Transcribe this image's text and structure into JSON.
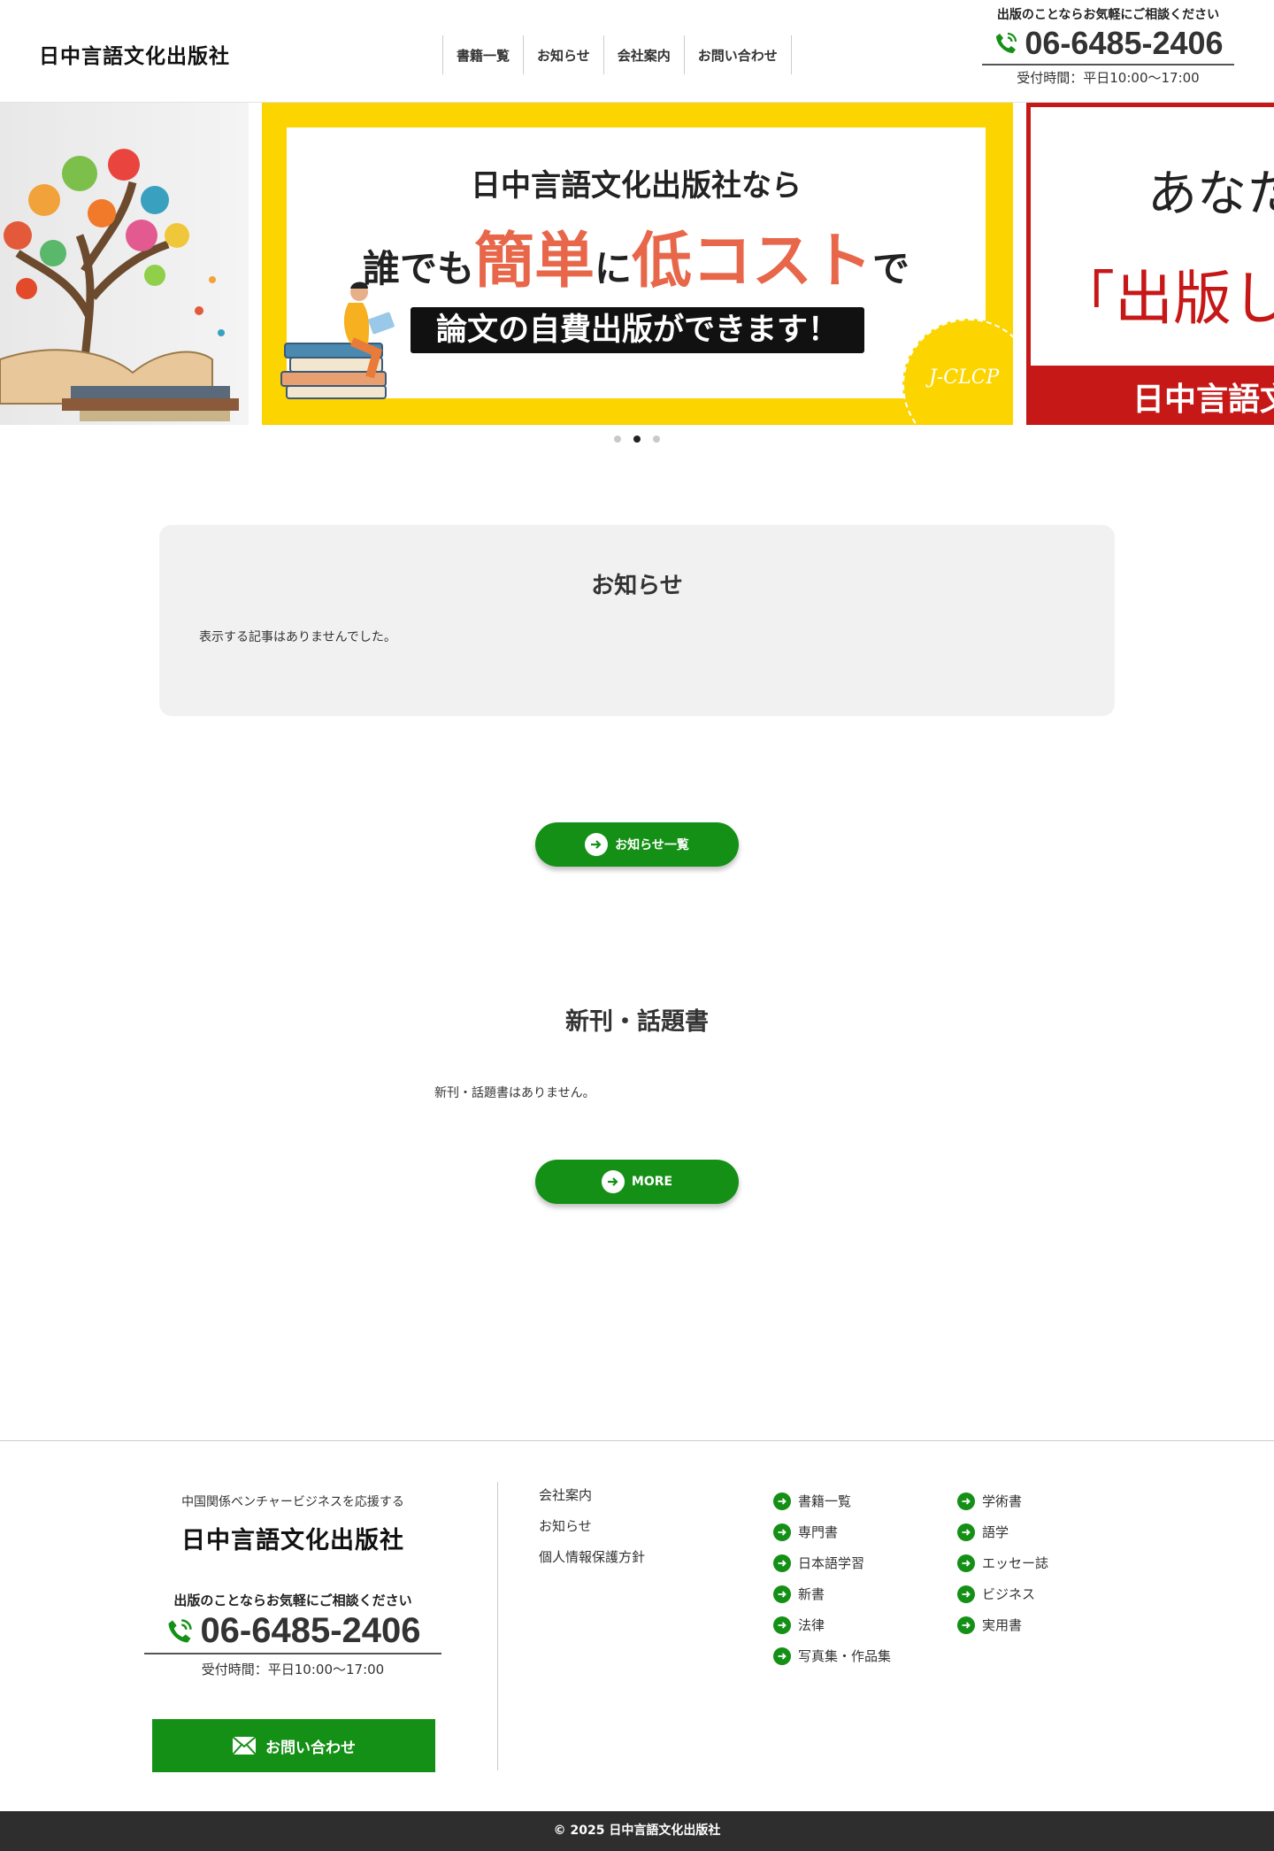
{
  "header": {
    "logo": "日中言語文化出版社",
    "nav": [
      "書籍一覧",
      "お知らせ",
      "会社案内",
      "お問い合わせ"
    ],
    "contact_lead": "出版のことならお気軽にご相談ください",
    "tel": "06-6485-2406",
    "hours": "受付時間：平日10:00〜17:00"
  },
  "slider": {
    "main": {
      "line1": "日中言語文化出版社なら",
      "line2_a": "誰でも",
      "line2_big1": "簡単",
      "line2_b": "に",
      "line2_big2": "低コスト",
      "line2_c": "で",
      "line3": "論文の自費出版ができます！",
      "badge": "J-CLCP"
    },
    "right": {
      "line1": "あなた",
      "line2": "「出版し",
      "line3": "日中言語文"
    },
    "active_index": 1,
    "count": 3
  },
  "news": {
    "title": "お知らせ",
    "empty_text": "表示する記事はありませんでした。",
    "button": "お知らせ一覧"
  },
  "new_books": {
    "title": "新刊・話題書",
    "empty_text": "新刊・話題書はありません。",
    "button": "MORE"
  },
  "footer": {
    "tagline": "中国関係ベンチャービジネスを応援する",
    "logo": "日中言語文化出版社",
    "contact_lead": "出版のことならお気軽にご相談ください",
    "tel": "06-6485-2406",
    "hours": "受付時間：平日10:00〜17:00",
    "contact_button": "お問い合わせ",
    "links": [
      "会社案内",
      "お知らせ",
      "個人情報保護方針"
    ],
    "categories_col1": [
      "書籍一覧",
      "専門書",
      "日本語学習",
      "新書",
      "法律",
      "写真集・作品集"
    ],
    "categories_col2": [
      "学術書",
      "語学",
      "エッセー誌",
      "ビジネス",
      "実用書"
    ],
    "copyright": "© 2025 日中言語文化出版社"
  },
  "colors": {
    "accent_green": "#159016",
    "banner_yellow": "#fcd400",
    "highlight_orange": "#e8674a",
    "banner_red": "#c71818"
  }
}
